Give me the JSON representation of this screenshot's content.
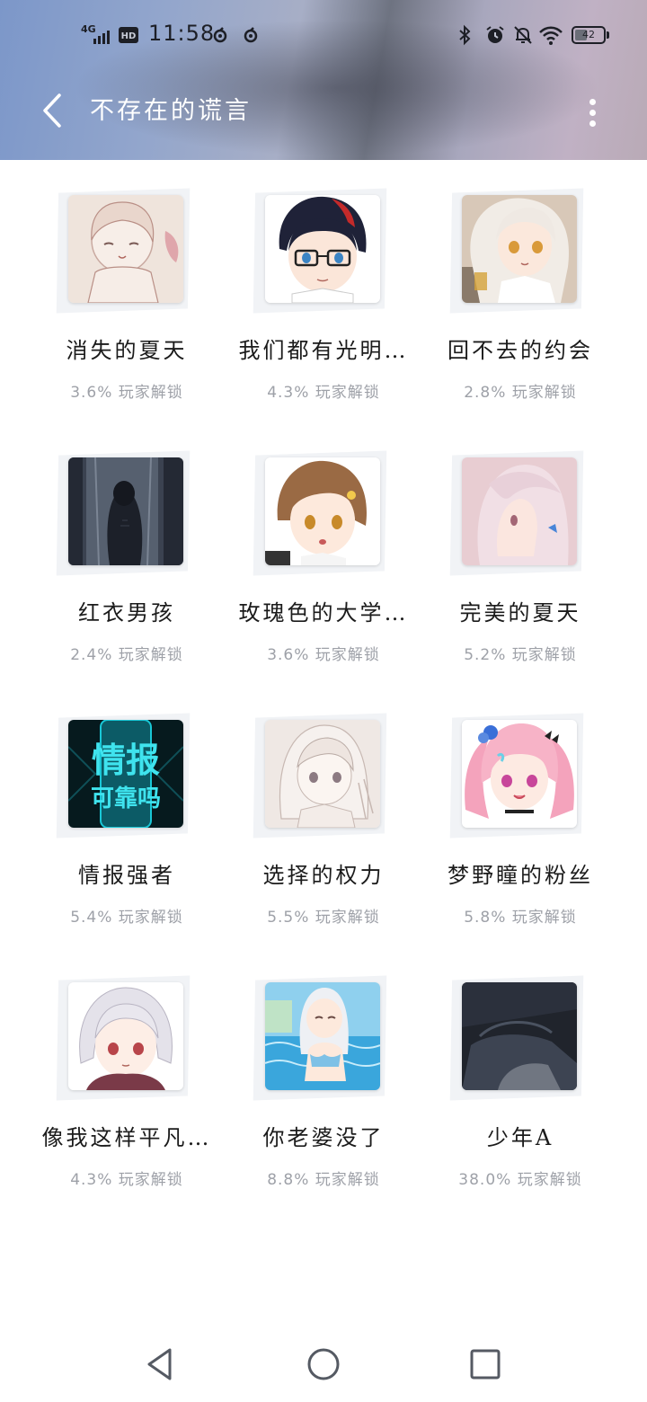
{
  "status_bar": {
    "network": "4G",
    "hd": "HD",
    "time": "11:58",
    "battery": "42",
    "battery_level": 0.42
  },
  "header": {
    "title": "不存在的谎言",
    "back_icon": "chevron-left-icon",
    "more_icon": "more-vertical-icon"
  },
  "achievements": [
    {
      "name": "消失的夏天",
      "unlock": "3.6% 玩家解锁"
    },
    {
      "name": "我们都有光明…",
      "unlock": "4.3% 玩家解锁"
    },
    {
      "name": "回不去的约会",
      "unlock": "2.8% 玩家解锁"
    },
    {
      "name": "红衣男孩",
      "unlock": "2.4% 玩家解锁"
    },
    {
      "name": "玫瑰色的大学…",
      "unlock": "3.6% 玩家解锁"
    },
    {
      "name": "完美的夏天",
      "unlock": "5.2% 玩家解锁"
    },
    {
      "name": "情报强者",
      "unlock": "5.4% 玩家解锁",
      "thumb_text_1": "情报",
      "thumb_text_2": "可靠吗"
    },
    {
      "name": "选择的权力",
      "unlock": "5.5% 玩家解锁"
    },
    {
      "name": "梦野瞳的粉丝",
      "unlock": "5.8% 玩家解锁"
    },
    {
      "name": "像我这样平凡…",
      "unlock": "4.3% 玩家解锁"
    },
    {
      "name": "你老婆没了",
      "unlock": "8.8% 玩家解锁"
    },
    {
      "name": "少年A",
      "unlock": "38.0% 玩家解锁"
    }
  ],
  "nav": {
    "back_icon": "triangle-back-icon",
    "home_icon": "circle-home-icon",
    "recents_icon": "square-recents-icon"
  },
  "colors": {
    "title_text": "#ffffff",
    "name_text": "#1b1b1b",
    "unlock_text": "#9ea1a8"
  }
}
